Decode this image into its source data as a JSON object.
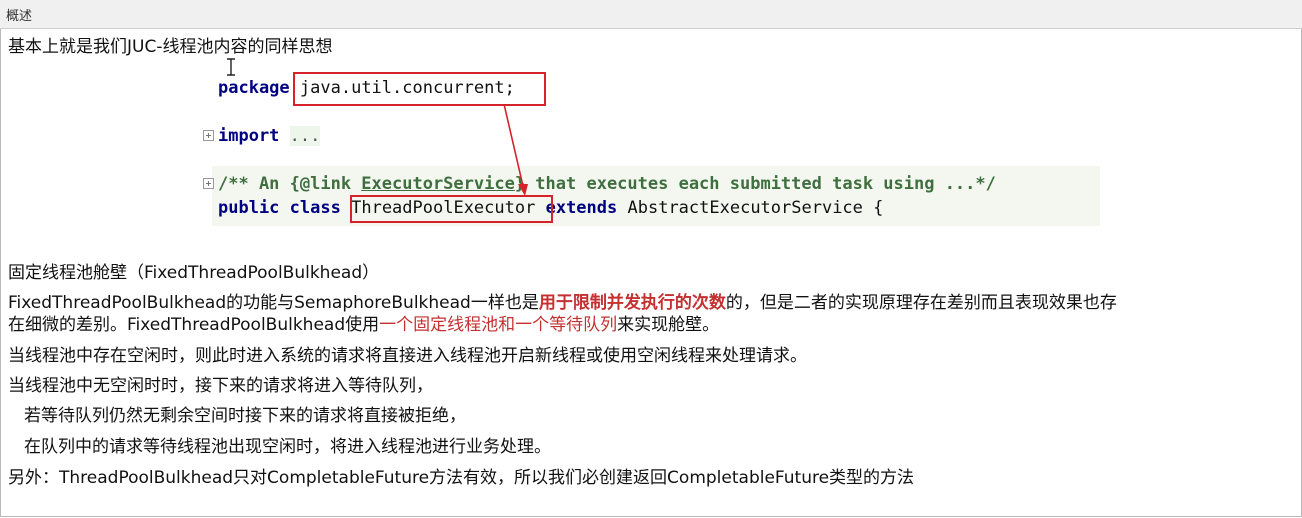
{
  "window": {
    "title": "概述"
  },
  "intro": "基本上就是我们JUC-线程池内容的同样思想",
  "code": {
    "package_kw": "package",
    "package_name": "java.util.concurrent;",
    "import_kw": "import",
    "import_rest": "...",
    "comment_start": "/** An {@link ",
    "comment_link": "ExecutorService",
    "comment_end": "} that executes each submitted task using ...*/",
    "public_kw": "public",
    "class_kw": "class",
    "class_name": "ThreadPoolExecutor",
    "extends_kw": "extends",
    "parent_class": "AbstractExecutorService {"
  },
  "section_title": "固定线程池舱壁（FixedThreadPoolBulkhead）",
  "para1": {
    "a": "FixedThreadPoolBulkhead的功能与SemaphoreBulkhead一样也是",
    "b": "用于限制并发执行的次数",
    "c": "的，但是二者的实现原理存在差别而且表现效果也存"
  },
  "para1_line2": {
    "a": "在细微的差别。FixedThreadPoolBulkhead使用",
    "b": "一个固定线程池和一个等待队列",
    "c": "来实现舱壁。"
  },
  "line_idle": "当线程池中存在空闲时，则此时进入系统的请求将直接进入线程池开启新线程或使用空闲线程来处理请求。",
  "line_no_idle": "当线程池中无空闲时时，接下来的请求将进入等待队列，",
  "line_reject": "若等待队列仍然无剩余空间时接下来的请求将直接被拒绝，",
  "line_queue": "在队列中的请求等待线程池出现空闲时，将进入线程池进行业务处理。",
  "line_other": "另外：ThreadPoolBulkhead只对CompletableFuture方法有效，所以我们必创建返回CompletableFuture类型的方法",
  "colors": {
    "annotation_red": "#d6222a",
    "emphasis_red": "#c53030",
    "keyword_navy": "#000080"
  }
}
